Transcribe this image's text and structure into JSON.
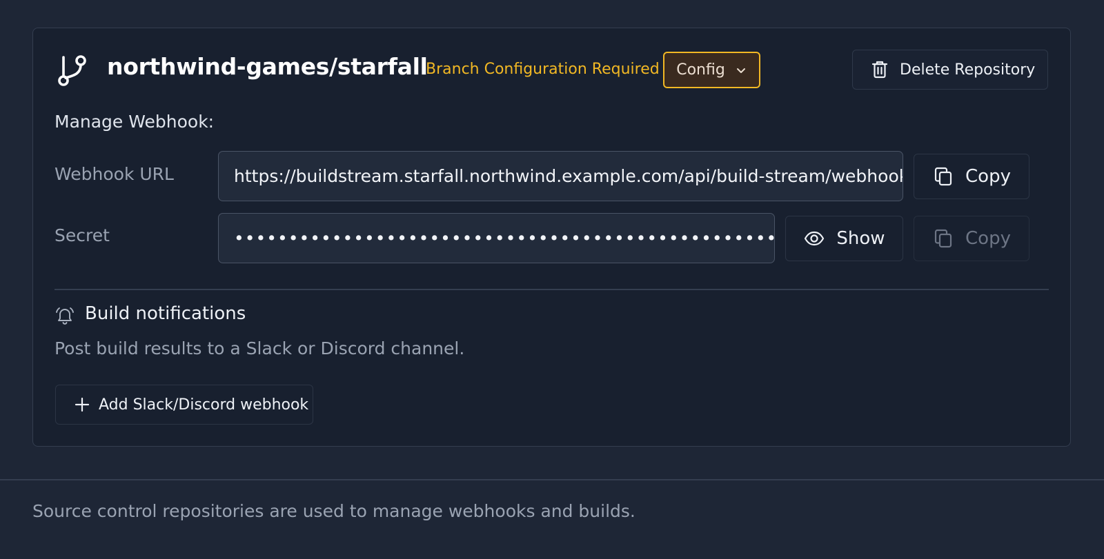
{
  "repository": {
    "name": "northwind-games/starfall",
    "icon": "git-branch-icon",
    "warning": "Branch Configuration Required",
    "config_label": "Config",
    "delete_label": "Delete Repository"
  },
  "webhook": {
    "section_label": "Manage Webhook:",
    "url_label": "Webhook URL",
    "url_value": "https://buildstream.starfall.northwind.example.com/api/build-stream/webhook",
    "secret_label": "Secret",
    "secret_value": "••••••••••••••••••••••••••••••••••••••••••••••••••••••••••••••",
    "copy_label": "Copy",
    "show_label": "Show"
  },
  "notifications": {
    "title": "Build notifications",
    "description": "Post build results to a Slack or Discord channel.",
    "add_label": "Add Slack/Discord webhook"
  },
  "footer": {
    "text": "Source control repositories are used to manage webhooks and builds."
  },
  "colors": {
    "warning": "#f2b824",
    "background": "#1e2636",
    "card": "#18202f"
  }
}
